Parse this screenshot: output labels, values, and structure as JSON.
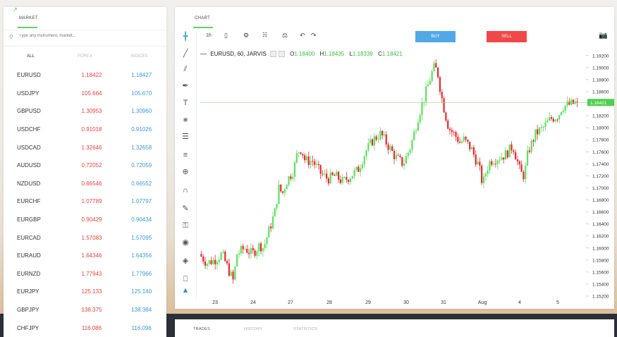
{
  "market": {
    "tab_label": "MARKET",
    "search_placeholder": "Type any instrument, market...",
    "filters": [
      "ALL",
      "FOREX",
      "INDICES"
    ],
    "rows": [
      {
        "symbol": "EURUSD",
        "bid": "1.18422",
        "ask": "1.18427"
      },
      {
        "symbol": "USDJPY",
        "bid": "105.664",
        "ask": "105.670"
      },
      {
        "symbol": "GBPUSD",
        "bid": "1.30953",
        "ask": "1.30960"
      },
      {
        "symbol": "USDCHF",
        "bid": "0.91018",
        "ask": "0.91026"
      },
      {
        "symbol": "USDCAD",
        "bid": "1.32646",
        "ask": "1.32658"
      },
      {
        "symbol": "AUDUSD",
        "bid": "0.72052",
        "ask": "0.72059"
      },
      {
        "symbol": "NZDUSD",
        "bid": "0.66546",
        "ask": "0.66552"
      },
      {
        "symbol": "EURCHF",
        "bid": "1.07789",
        "ask": "1.07797"
      },
      {
        "symbol": "EURGBP",
        "bid": "0.90429",
        "ask": "0.90434"
      },
      {
        "symbol": "EURCAD",
        "bid": "1.57083",
        "ask": "1.57095"
      },
      {
        "symbol": "EURAUD",
        "bid": "1.64346",
        "ask": "1.64356"
      },
      {
        "symbol": "EURNZD",
        "bid": "1.77943",
        "ask": "1.77966"
      },
      {
        "symbol": "EURJPY",
        "bid": "125.133",
        "ask": "125.140"
      },
      {
        "symbol": "GBPJPY",
        "bid": "138.375",
        "ask": "138.384"
      },
      {
        "symbol": "CHFJPY",
        "bid": "116.086",
        "ask": "116.096"
      }
    ],
    "arrow_row": 12
  },
  "chart_panel": {
    "tab_label": "CHART",
    "timeframe": "1h",
    "buy_label": "BUY",
    "sell_label": "SELL",
    "legend": {
      "symbol_line": "EURUSD, 60, JARVIS",
      "o_label": "O",
      "o_value": "1.18400",
      "h_label": "H",
      "h_value": "1.18435",
      "l_label": "L",
      "l_value": "1.18339",
      "c_label": "C",
      "c_value": "1.18421"
    },
    "tools": [
      "crosshair-icon",
      "trend-line-icon",
      "pitchfork-icon",
      "brush-icon",
      "text-icon",
      "pattern-icon",
      "fib-icon",
      "measure-icon",
      "zoom-icon",
      "magnet-icon",
      "lock-drawing-icon",
      "lock-icon",
      "eye-icon",
      "layers-icon",
      "trash-icon"
    ],
    "colors": {
      "up": "#5de05d",
      "down": "#e8282b",
      "last_line": "#8fdc8f",
      "price_tag": "#4fcf4f"
    }
  },
  "chart_data": {
    "type": "candlestick",
    "symbol": "EURUSD",
    "timeframe_minutes": 60,
    "x_ticks": [
      "23",
      "24",
      "27",
      "28",
      "29",
      "30",
      "31",
      "Aug",
      "4",
      "5"
    ],
    "y_ticks": [
      "1.19200",
      "1.19000",
      "1.18800",
      "1.18600",
      "1.18400",
      "1.18200",
      "1.18000",
      "1.17800",
      "1.17600",
      "1.17400",
      "1.17200",
      "1.17000",
      "1.16800",
      "1.16600",
      "1.16400",
      "1.16200",
      "1.16000",
      "1.15800",
      "1.15600",
      "1.15400",
      "1.15200"
    ],
    "ylim": [
      1.152,
      1.1928
    ],
    "last_price": "1.18421",
    "last_value": 1.18421,
    "close_path": [
      [
        0.0,
        1.159
      ],
      [
        0.02,
        1.1575
      ],
      [
        0.04,
        1.158
      ],
      [
        0.06,
        1.159
      ],
      [
        0.08,
        1.156
      ],
      [
        0.09,
        1.1545
      ],
      [
        0.1,
        1.159
      ],
      [
        0.12,
        1.16
      ],
      [
        0.14,
        1.159
      ],
      [
        0.16,
        1.1605
      ],
      [
        0.17,
        1.16
      ],
      [
        0.18,
        1.162
      ],
      [
        0.2,
        1.166
      ],
      [
        0.21,
        1.17
      ],
      [
        0.22,
        1.169
      ],
      [
        0.23,
        1.171
      ],
      [
        0.25,
        1.173
      ],
      [
        0.26,
        1.176
      ],
      [
        0.27,
        1.1765
      ],
      [
        0.28,
        1.1745
      ],
      [
        0.3,
        1.1745
      ],
      [
        0.32,
        1.1725
      ],
      [
        0.34,
        1.1715
      ],
      [
        0.36,
        1.172
      ],
      [
        0.38,
        1.171
      ],
      [
        0.4,
        1.172
      ],
      [
        0.42,
        1.173
      ],
      [
        0.44,
        1.176
      ],
      [
        0.46,
        1.178
      ],
      [
        0.48,
        1.179
      ],
      [
        0.5,
        1.177
      ],
      [
        0.52,
        1.175
      ],
      [
        0.54,
        1.174
      ],
      [
        0.56,
        1.177
      ],
      [
        0.58,
        1.182
      ],
      [
        0.6,
        1.186
      ],
      [
        0.61,
        1.188
      ],
      [
        0.62,
        1.19
      ],
      [
        0.63,
        1.1895
      ],
      [
        0.64,
        1.1855
      ],
      [
        0.65,
        1.1825
      ],
      [
        0.66,
        1.18
      ],
      [
        0.68,
        1.1785
      ],
      [
        0.69,
        1.1775
      ],
      [
        0.7,
        1.178
      ],
      [
        0.72,
        1.1765
      ],
      [
        0.74,
        1.1735
      ],
      [
        0.75,
        1.1705
      ],
      [
        0.76,
        1.173
      ],
      [
        0.77,
        1.1745
      ],
      [
        0.79,
        1.175
      ],
      [
        0.81,
        1.1755
      ],
      [
        0.83,
        1.177
      ],
      [
        0.85,
        1.1725
      ],
      [
        0.86,
        1.172
      ],
      [
        0.87,
        1.176
      ],
      [
        0.89,
        1.179
      ],
      [
        0.91,
        1.18
      ],
      [
        0.93,
        1.1815
      ],
      [
        0.95,
        1.182
      ],
      [
        0.96,
        1.1835
      ],
      [
        1.0,
        1.1842
      ]
    ]
  },
  "bottom_tabs": [
    "TRADES",
    "HISTORY",
    "STATISTICS"
  ]
}
